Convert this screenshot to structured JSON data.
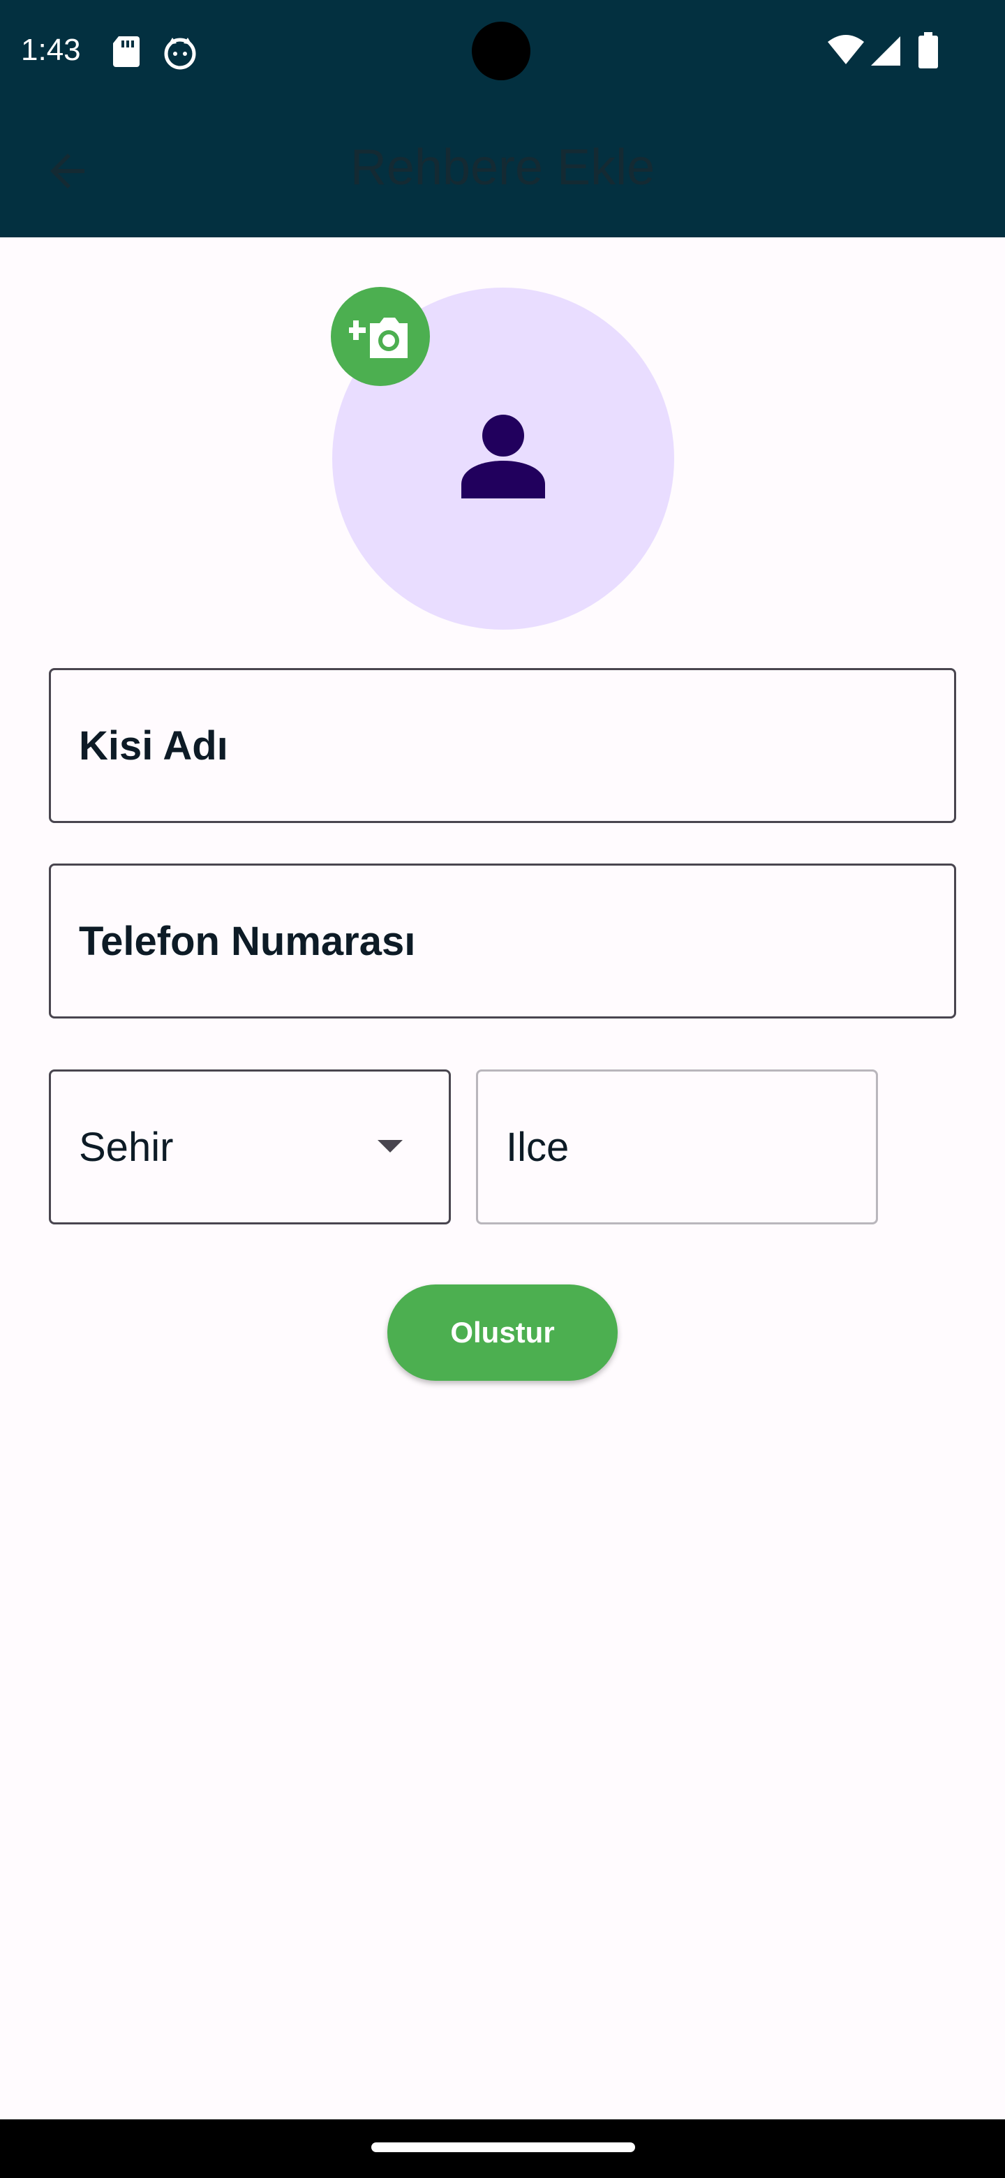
{
  "status_bar": {
    "time": "1:43",
    "icons_left": [
      "sd-card-icon",
      "cat-face-icon"
    ],
    "icons_right": [
      "wifi-icon",
      "signal-icon",
      "battery-icon"
    ]
  },
  "app_bar": {
    "title": "Rehbere Ekle",
    "back_icon": "arrow-back-icon",
    "background": "#033040"
  },
  "avatar": {
    "icon": "person-icon",
    "background": "#e9ddff",
    "add_photo_icon": "add-a-photo-icon"
  },
  "form": {
    "name_label": "Kisi Adı",
    "phone_label": "Telefon Numarası",
    "city_label": "Sehir",
    "district_label": "Ilce",
    "create_label": "Olustur"
  },
  "colors": {
    "accent": "#4caf50",
    "person_icon": "#21005d",
    "background": "#fffbfe"
  }
}
